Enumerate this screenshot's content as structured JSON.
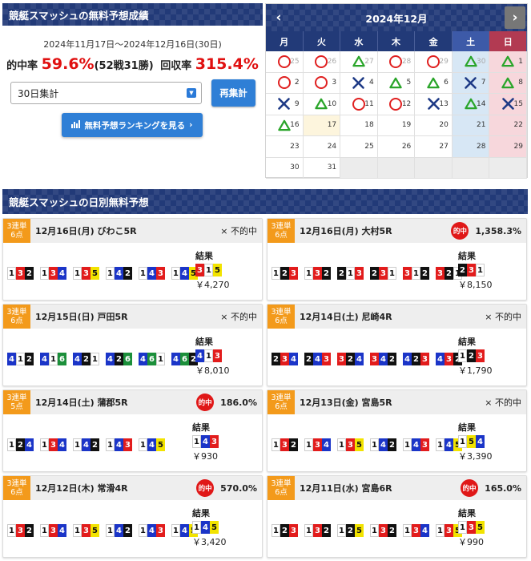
{
  "stats": {
    "title": "競艇スマッシュの無料予想成績",
    "period": "2024年11月17日～2024年12月16日(30日)",
    "hit_label": "的中率",
    "hit_rate": "59.6%",
    "record": "(52戦31勝)",
    "return_label": "回収率",
    "return_rate": "315.4%",
    "select_value": "30日集計",
    "recalc_label": "再集計",
    "ranking_label": "無料予想ランキングを見る"
  },
  "calendar": {
    "title": "2024年12月",
    "weekdays": [
      "月",
      "火",
      "水",
      "木",
      "金",
      "土",
      "日"
    ],
    "cells": [
      {
        "d": "25",
        "m": "circle",
        "o": 1
      },
      {
        "d": "26",
        "m": "circle",
        "o": 1
      },
      {
        "d": "27",
        "m": "tri",
        "o": 1
      },
      {
        "d": "28",
        "m": "circle",
        "o": 1
      },
      {
        "d": "29",
        "m": "circle",
        "o": 1
      },
      {
        "d": "30",
        "m": "tri",
        "o": 1
      },
      {
        "d": "1",
        "m": "tri"
      },
      {
        "d": "2",
        "m": "circle"
      },
      {
        "d": "3",
        "m": "circle"
      },
      {
        "d": "4",
        "m": "cross"
      },
      {
        "d": "5",
        "m": "tri"
      },
      {
        "d": "6",
        "m": "tri"
      },
      {
        "d": "7",
        "m": "cross"
      },
      {
        "d": "8",
        "m": "tri"
      },
      {
        "d": "9",
        "m": "cross"
      },
      {
        "d": "10",
        "m": "tri"
      },
      {
        "d": "11",
        "m": "circle"
      },
      {
        "d": "12",
        "m": "circle"
      },
      {
        "d": "13",
        "m": "cross"
      },
      {
        "d": "14",
        "m": "tri"
      },
      {
        "d": "15",
        "m": "cross"
      },
      {
        "d": "16",
        "m": "tri"
      },
      {
        "d": "17",
        "m": "",
        "t": 1
      },
      {
        "d": "18",
        "m": ""
      },
      {
        "d": "19",
        "m": ""
      },
      {
        "d": "20",
        "m": ""
      },
      {
        "d": "21",
        "m": ""
      },
      {
        "d": "22",
        "m": ""
      },
      {
        "d": "23",
        "m": ""
      },
      {
        "d": "24",
        "m": ""
      },
      {
        "d": "25",
        "m": ""
      },
      {
        "d": "26",
        "m": ""
      },
      {
        "d": "27",
        "m": ""
      },
      {
        "d": "28",
        "m": ""
      },
      {
        "d": "29",
        "m": ""
      },
      {
        "d": "30",
        "m": ""
      },
      {
        "d": "31",
        "m": ""
      },
      {
        "d": "",
        "m": "",
        "e": 1
      },
      {
        "d": "",
        "m": "",
        "e": 1
      },
      {
        "d": "",
        "m": "",
        "e": 1
      },
      {
        "d": "",
        "m": "",
        "e": 1
      },
      {
        "d": "",
        "m": "",
        "e": 1
      }
    ]
  },
  "daily": {
    "title": "競艇スマッシュの日別無料予想",
    "result_label": "結果",
    "cards": [
      {
        "bet": "3連単",
        "points": "6点",
        "race": "12月16日(月) びわこ5R",
        "status": "× 不的中",
        "hit": false,
        "pct": "",
        "combos": [
          "132",
          "134",
          "135",
          "142",
          "143",
          "145"
        ],
        "result": "315",
        "payout": "￥4,270"
      },
      {
        "bet": "3連単",
        "points": "6点",
        "race": "12月16日(月) 大村5R",
        "status": "",
        "hit": true,
        "hit_label": "的中",
        "pct": "1,358.3%",
        "combos": [
          "123",
          "132",
          "213",
          "231",
          "312",
          "321"
        ],
        "result": "231",
        "payout": "￥8,150"
      },
      {
        "bet": "3連単",
        "points": "6点",
        "race": "12月15日(日) 戸田5R",
        "status": "× 不的中",
        "hit": false,
        "pct": "",
        "combos": [
          "412",
          "416",
          "421",
          "426",
          "461",
          "462"
        ],
        "result": "413",
        "payout": "￥8,010"
      },
      {
        "bet": "3連単",
        "points": "6点",
        "race": "12月14日(土) 尼崎4R",
        "status": "× 不的中",
        "hit": false,
        "pct": "",
        "combos": [
          "234",
          "243",
          "324",
          "342",
          "423",
          "432"
        ],
        "result": "123",
        "payout": "￥1,790"
      },
      {
        "bet": "3連単",
        "points": "5点",
        "race": "12月14日(土) 蒲郡5R",
        "status": "",
        "hit": true,
        "hit_label": "的中",
        "pct": "186.0%",
        "combos": [
          "124",
          "134",
          "142",
          "143",
          "145"
        ],
        "result": "143",
        "payout": "￥930"
      },
      {
        "bet": "3連単",
        "points": "6点",
        "race": "12月13日(金) 宮島5R",
        "status": "× 不的中",
        "hit": false,
        "pct": "",
        "combos": [
          "132",
          "134",
          "135",
          "142",
          "143",
          "145"
        ],
        "result": "154",
        "payout": "￥3,390"
      },
      {
        "bet": "3連単",
        "points": "6点",
        "race": "12月12日(木) 常滑4R",
        "status": "",
        "hit": true,
        "hit_label": "的中",
        "pct": "570.0%",
        "combos": [
          "132",
          "134",
          "135",
          "142",
          "143",
          "145"
        ],
        "result": "145",
        "payout": "￥3,420"
      },
      {
        "bet": "3連単",
        "points": "6点",
        "race": "12月11日(水) 宮島6R",
        "status": "",
        "hit": true,
        "hit_label": "的中",
        "pct": "165.0%",
        "combos": [
          "123",
          "132",
          "125",
          "132",
          "134",
          "135"
        ],
        "result": "135",
        "payout": "￥990"
      }
    ]
  }
}
